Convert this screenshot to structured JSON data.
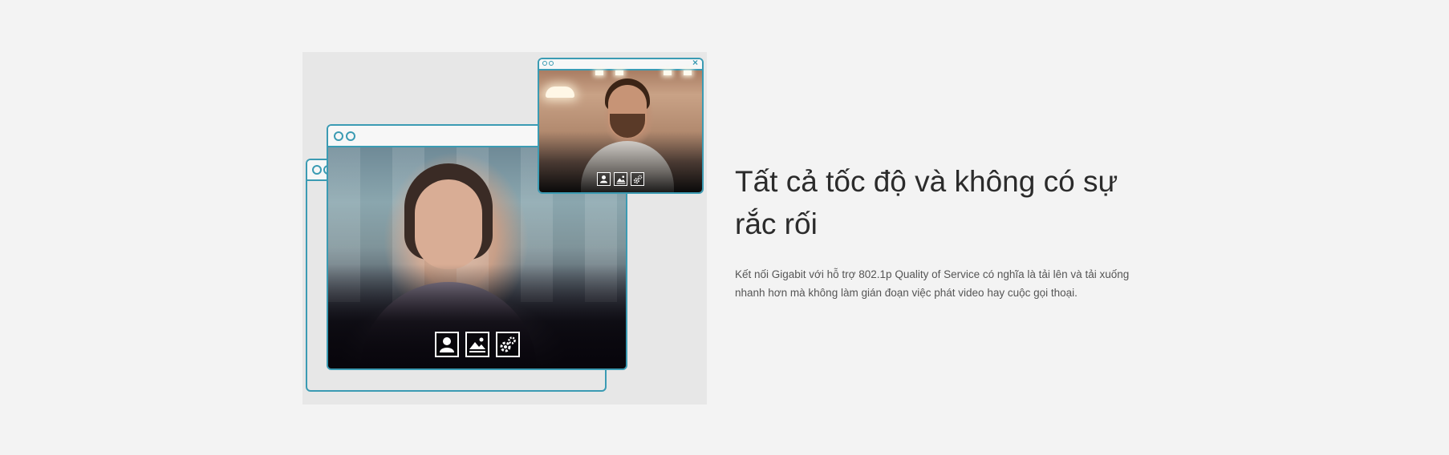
{
  "feature": {
    "headline": "Tất cả tốc độ và không có sự rắc rối",
    "description": "Kết nối Gigabit với hỗ trợ 802.1p Quality of Service có nghĩa là tải lên và tải xuống nhanh hơn mà không làm gián đoạn việc phát video hay cuộc gọi thoại."
  },
  "illustration": {
    "small_window_close": "×",
    "controls": [
      {
        "icon": "user-icon"
      },
      {
        "icon": "image-icon"
      },
      {
        "icon": "gear-icon"
      }
    ]
  },
  "colors": {
    "window_border": "#3b9bb3",
    "background": "#f3f3f3",
    "panel": "#e7e7e7",
    "headline": "#2b2b2b",
    "body_text": "#555555"
  }
}
